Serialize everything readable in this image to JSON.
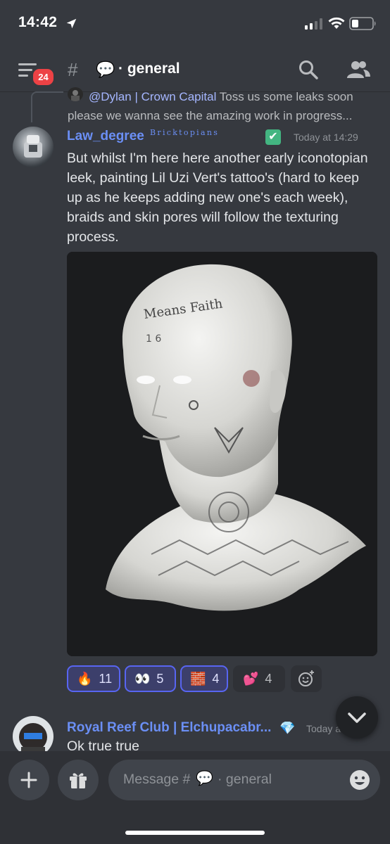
{
  "status_bar": {
    "time": "14:42"
  },
  "header": {
    "badge_count": "24",
    "channel_emoji": "💬",
    "channel_name": "· general"
  },
  "reply": {
    "author": "@Dylan | Crown Capital",
    "text": "Toss us some leaks soon please we wanna see the amazing work in progress..."
  },
  "message1": {
    "author": "Law_degree",
    "tag": "Bricktopians",
    "verified": "✔",
    "timestamp": "Today at 14:29",
    "text": "But whilst I'm here here another early iconotopian leek, painting Lil Uzi Vert's tattoo's (hard to keep up as he keeps adding new one's each week), braids and skin pores will follow the texturing process.",
    "image_alt": "3D head sculpt with face and neck tattoos",
    "reactions": [
      {
        "emoji": "🔥",
        "count": "11",
        "active": true
      },
      {
        "emoji": "👀",
        "count": "5",
        "active": true
      },
      {
        "emoji": "🧱",
        "count": "4",
        "active": true
      },
      {
        "emoji": "💕",
        "count": "4",
        "active": false
      }
    ]
  },
  "message2": {
    "author": "Royal Reef Club | Elchupacabr...",
    "badge": "💎",
    "timestamp": "Today at 14:29",
    "text": "Ok true true"
  },
  "composer": {
    "placeholder_prefix": "Message #",
    "placeholder_emoji": "💬",
    "placeholder_channel": "· general"
  },
  "colors": {
    "background": "#36393f",
    "accent": "#5865f2",
    "author": "#6b8ff5",
    "badge_red": "#ed4245"
  }
}
